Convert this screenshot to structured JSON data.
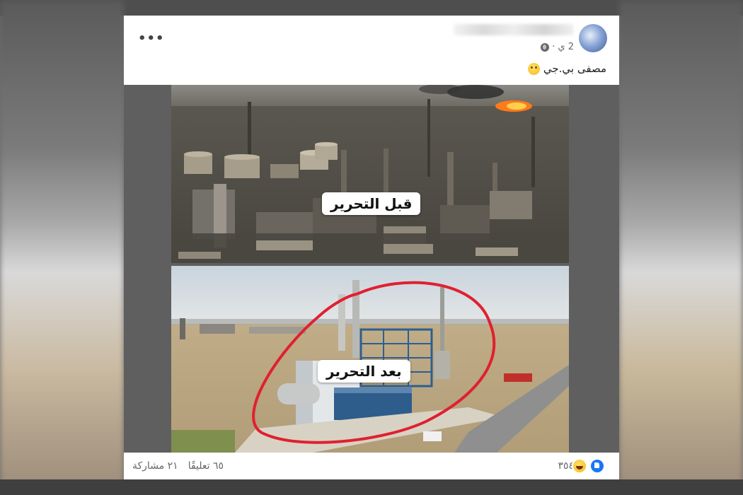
{
  "post": {
    "time": "2 ي",
    "separator": "·",
    "caption": "مصفى بي.جي",
    "options_icon": "more-options-icon",
    "privacy_icon": "globe-icon",
    "emoji_icon": "thinking-face-icon"
  },
  "images": {
    "before_label": "قبل التحرير",
    "after_label": "بعد التحرير"
  },
  "footer": {
    "reaction_count": "٣٥٤",
    "comments": "٦٥ تعليقًا",
    "shares": "٢١ مشاركة",
    "reaction_icons": [
      "like-icon",
      "haha-icon"
    ]
  },
  "colors": {
    "accent": "#1877f2",
    "circle": "#e02030",
    "secondary_text": "#65676b"
  }
}
